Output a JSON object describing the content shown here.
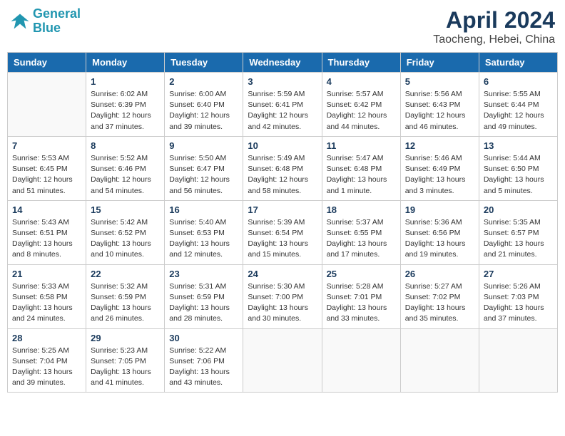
{
  "header": {
    "logo_line1": "General",
    "logo_line2": "Blue",
    "title": "April 2024",
    "subtitle": "Taocheng, Hebei, China"
  },
  "weekdays": [
    "Sunday",
    "Monday",
    "Tuesday",
    "Wednesday",
    "Thursday",
    "Friday",
    "Saturday"
  ],
  "weeks": [
    [
      {
        "day": "",
        "info": ""
      },
      {
        "day": "1",
        "info": "Sunrise: 6:02 AM\nSunset: 6:39 PM\nDaylight: 12 hours\nand 37 minutes."
      },
      {
        "day": "2",
        "info": "Sunrise: 6:00 AM\nSunset: 6:40 PM\nDaylight: 12 hours\nand 39 minutes."
      },
      {
        "day": "3",
        "info": "Sunrise: 5:59 AM\nSunset: 6:41 PM\nDaylight: 12 hours\nand 42 minutes."
      },
      {
        "day": "4",
        "info": "Sunrise: 5:57 AM\nSunset: 6:42 PM\nDaylight: 12 hours\nand 44 minutes."
      },
      {
        "day": "5",
        "info": "Sunrise: 5:56 AM\nSunset: 6:43 PM\nDaylight: 12 hours\nand 46 minutes."
      },
      {
        "day": "6",
        "info": "Sunrise: 5:55 AM\nSunset: 6:44 PM\nDaylight: 12 hours\nand 49 minutes."
      }
    ],
    [
      {
        "day": "7",
        "info": "Sunrise: 5:53 AM\nSunset: 6:45 PM\nDaylight: 12 hours\nand 51 minutes."
      },
      {
        "day": "8",
        "info": "Sunrise: 5:52 AM\nSunset: 6:46 PM\nDaylight: 12 hours\nand 54 minutes."
      },
      {
        "day": "9",
        "info": "Sunrise: 5:50 AM\nSunset: 6:47 PM\nDaylight: 12 hours\nand 56 minutes."
      },
      {
        "day": "10",
        "info": "Sunrise: 5:49 AM\nSunset: 6:48 PM\nDaylight: 12 hours\nand 58 minutes."
      },
      {
        "day": "11",
        "info": "Sunrise: 5:47 AM\nSunset: 6:48 PM\nDaylight: 13 hours\nand 1 minute."
      },
      {
        "day": "12",
        "info": "Sunrise: 5:46 AM\nSunset: 6:49 PM\nDaylight: 13 hours\nand 3 minutes."
      },
      {
        "day": "13",
        "info": "Sunrise: 5:44 AM\nSunset: 6:50 PM\nDaylight: 13 hours\nand 5 minutes."
      }
    ],
    [
      {
        "day": "14",
        "info": "Sunrise: 5:43 AM\nSunset: 6:51 PM\nDaylight: 13 hours\nand 8 minutes."
      },
      {
        "day": "15",
        "info": "Sunrise: 5:42 AM\nSunset: 6:52 PM\nDaylight: 13 hours\nand 10 minutes."
      },
      {
        "day": "16",
        "info": "Sunrise: 5:40 AM\nSunset: 6:53 PM\nDaylight: 13 hours\nand 12 minutes."
      },
      {
        "day": "17",
        "info": "Sunrise: 5:39 AM\nSunset: 6:54 PM\nDaylight: 13 hours\nand 15 minutes."
      },
      {
        "day": "18",
        "info": "Sunrise: 5:37 AM\nSunset: 6:55 PM\nDaylight: 13 hours\nand 17 minutes."
      },
      {
        "day": "19",
        "info": "Sunrise: 5:36 AM\nSunset: 6:56 PM\nDaylight: 13 hours\nand 19 minutes."
      },
      {
        "day": "20",
        "info": "Sunrise: 5:35 AM\nSunset: 6:57 PM\nDaylight: 13 hours\nand 21 minutes."
      }
    ],
    [
      {
        "day": "21",
        "info": "Sunrise: 5:33 AM\nSunset: 6:58 PM\nDaylight: 13 hours\nand 24 minutes."
      },
      {
        "day": "22",
        "info": "Sunrise: 5:32 AM\nSunset: 6:59 PM\nDaylight: 13 hours\nand 26 minutes."
      },
      {
        "day": "23",
        "info": "Sunrise: 5:31 AM\nSunset: 6:59 PM\nDaylight: 13 hours\nand 28 minutes."
      },
      {
        "day": "24",
        "info": "Sunrise: 5:30 AM\nSunset: 7:00 PM\nDaylight: 13 hours\nand 30 minutes."
      },
      {
        "day": "25",
        "info": "Sunrise: 5:28 AM\nSunset: 7:01 PM\nDaylight: 13 hours\nand 33 minutes."
      },
      {
        "day": "26",
        "info": "Sunrise: 5:27 AM\nSunset: 7:02 PM\nDaylight: 13 hours\nand 35 minutes."
      },
      {
        "day": "27",
        "info": "Sunrise: 5:26 AM\nSunset: 7:03 PM\nDaylight: 13 hours\nand 37 minutes."
      }
    ],
    [
      {
        "day": "28",
        "info": "Sunrise: 5:25 AM\nSunset: 7:04 PM\nDaylight: 13 hours\nand 39 minutes."
      },
      {
        "day": "29",
        "info": "Sunrise: 5:23 AM\nSunset: 7:05 PM\nDaylight: 13 hours\nand 41 minutes."
      },
      {
        "day": "30",
        "info": "Sunrise: 5:22 AM\nSunset: 7:06 PM\nDaylight: 13 hours\nand 43 minutes."
      },
      {
        "day": "",
        "info": ""
      },
      {
        "day": "",
        "info": ""
      },
      {
        "day": "",
        "info": ""
      },
      {
        "day": "",
        "info": ""
      }
    ]
  ]
}
